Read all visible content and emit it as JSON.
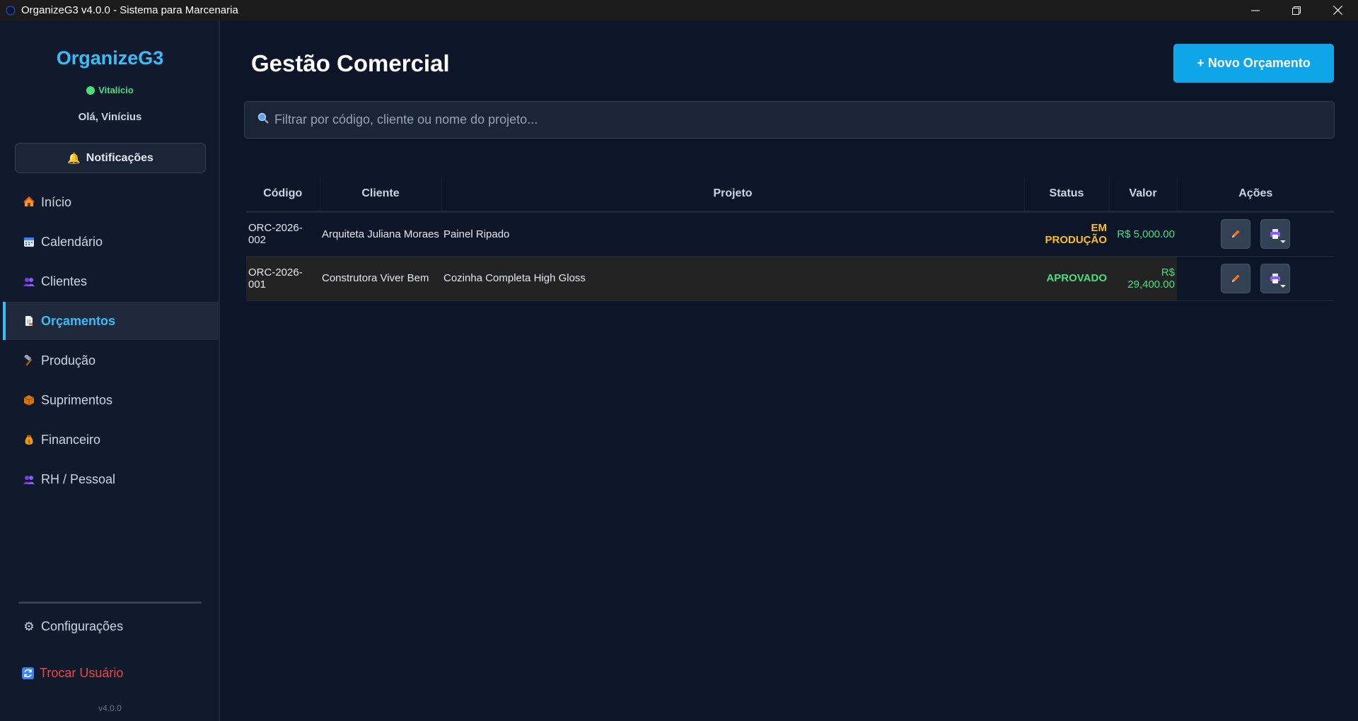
{
  "window": {
    "title": "OrganizeG3 v4.0.0 - Sistema para Marcenaria"
  },
  "sidebar": {
    "logo": "OrganizeG3",
    "license": "Vitalício",
    "greeting": "Olá, Vinícius",
    "notifications_label": "Notificações",
    "items": [
      {
        "label": "Início",
        "icon": "house-icon"
      },
      {
        "label": "Calendário",
        "icon": "calendar-icon"
      },
      {
        "label": "Clientes",
        "icon": "users-icon"
      },
      {
        "label": "Orçamentos",
        "icon": "document-icon",
        "active": true
      },
      {
        "label": "Produção",
        "icon": "hammer-icon"
      },
      {
        "label": "Suprimentos",
        "icon": "package-icon"
      },
      {
        "label": "Financeiro",
        "icon": "money-bag-icon"
      },
      {
        "label": "RH / Pessoal",
        "icon": "users-icon"
      }
    ],
    "settings_label": "Configurações",
    "switch_user_label": "Trocar Usuário",
    "version": "v4.0.0"
  },
  "main": {
    "title": "Gestão Comercial",
    "new_button": "+ Novo Orçamento",
    "search_placeholder": "Filtrar por código, cliente ou nome do projeto...",
    "table": {
      "headers": [
        "Código",
        "Cliente",
        "Projeto",
        "Status",
        "Valor",
        "Ações"
      ],
      "rows": [
        {
          "code": "ORC-2026-002",
          "client": "Arquiteta Juliana Moraes",
          "project": "Painel Ripado",
          "status": "EM PRODUÇÃO",
          "value": "R$ 5,000.00"
        },
        {
          "code": "ORC-2026-001",
          "client": "Construtora Viver Bem",
          "project": "Cozinha Completa High Gloss",
          "status": "APROVADO",
          "value": "R$ 29,400.00"
        }
      ]
    }
  },
  "colors": {
    "accent": "#38bdf8",
    "primary_button": "#0ea5e9",
    "status_production": "#fbbf24",
    "status_approved": "#4ade80",
    "danger": "#ef4444"
  }
}
